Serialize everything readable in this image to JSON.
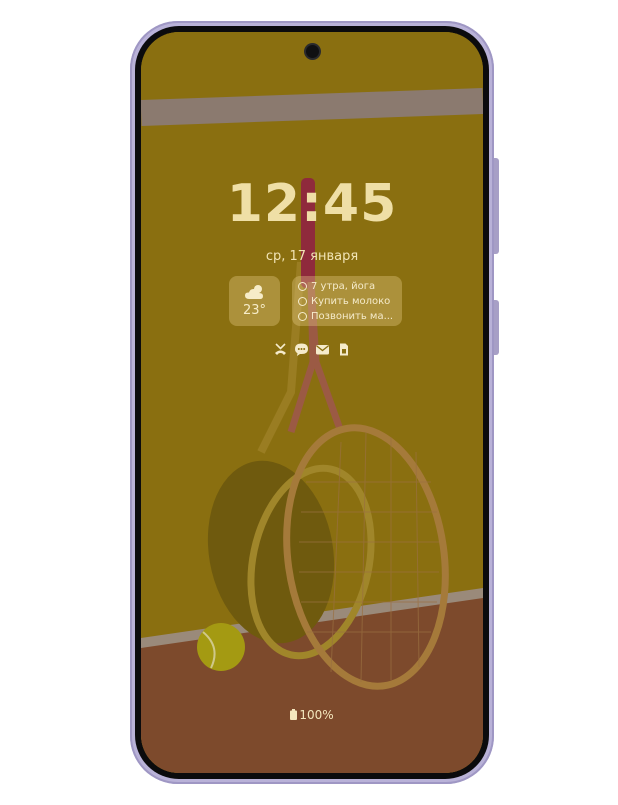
{
  "lockscreen": {
    "time": "12:45",
    "date": "ср, 17 января",
    "weather": {
      "icon": "cloud-sun-icon",
      "temperature": "23°"
    },
    "reminders": [
      {
        "text": "7 утра, йога"
      },
      {
        "text": "Купить молоко"
      },
      {
        "text": "Позвонить ма..."
      }
    ],
    "notification_icons": [
      "missed-call-icon",
      "message-icon",
      "mail-icon",
      "sim-icon"
    ],
    "battery": "100%"
  },
  "colors": {
    "frame": "#b9b2d8",
    "wallpaper_wall": "#8a6f10",
    "wallpaper_floor": "#8a4a2a",
    "clock_text": "#efdfa6"
  }
}
